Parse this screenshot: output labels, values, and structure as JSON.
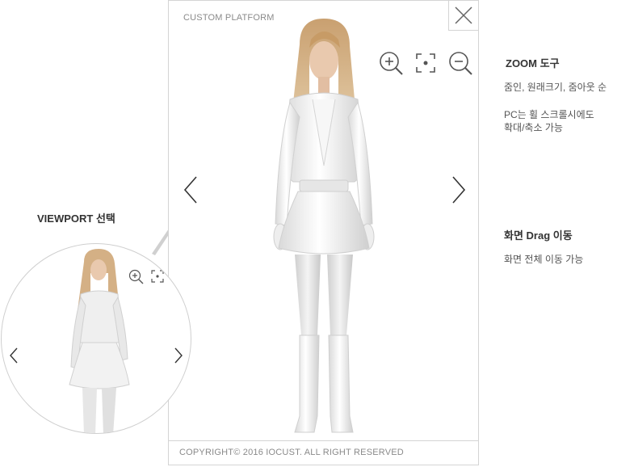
{
  "viewer": {
    "brand": "CUSTOM PLATFORM",
    "footer": "COPYRIGHT© 2016 IOCUST. ALL RIGHT RESERVED",
    "icons": {
      "close": "close-icon",
      "zoom_in": "zoom-in-icon",
      "actual_size": "actual-size-icon",
      "zoom_out": "zoom-out-icon",
      "prev": "chevron-left-icon",
      "next": "chevron-right-icon"
    }
  },
  "viewport_callout": {
    "title": "VIEWPORT 선택"
  },
  "annotations": {
    "zoom": {
      "title": "ZOOM 도구",
      "line1": "줌인, 원래크기, 줌아웃 순",
      "line2": "PC는 휠 스크롤시에도",
      "line3": "확대/축소 가능"
    },
    "drag": {
      "title": "화면 Drag 이동",
      "line1": "화면 전체 이동 가능"
    }
  },
  "colors": {
    "border": "#d4d4d4",
    "text_muted": "#8a8a8a",
    "text_dark": "#333333",
    "icon": "#555555"
  }
}
